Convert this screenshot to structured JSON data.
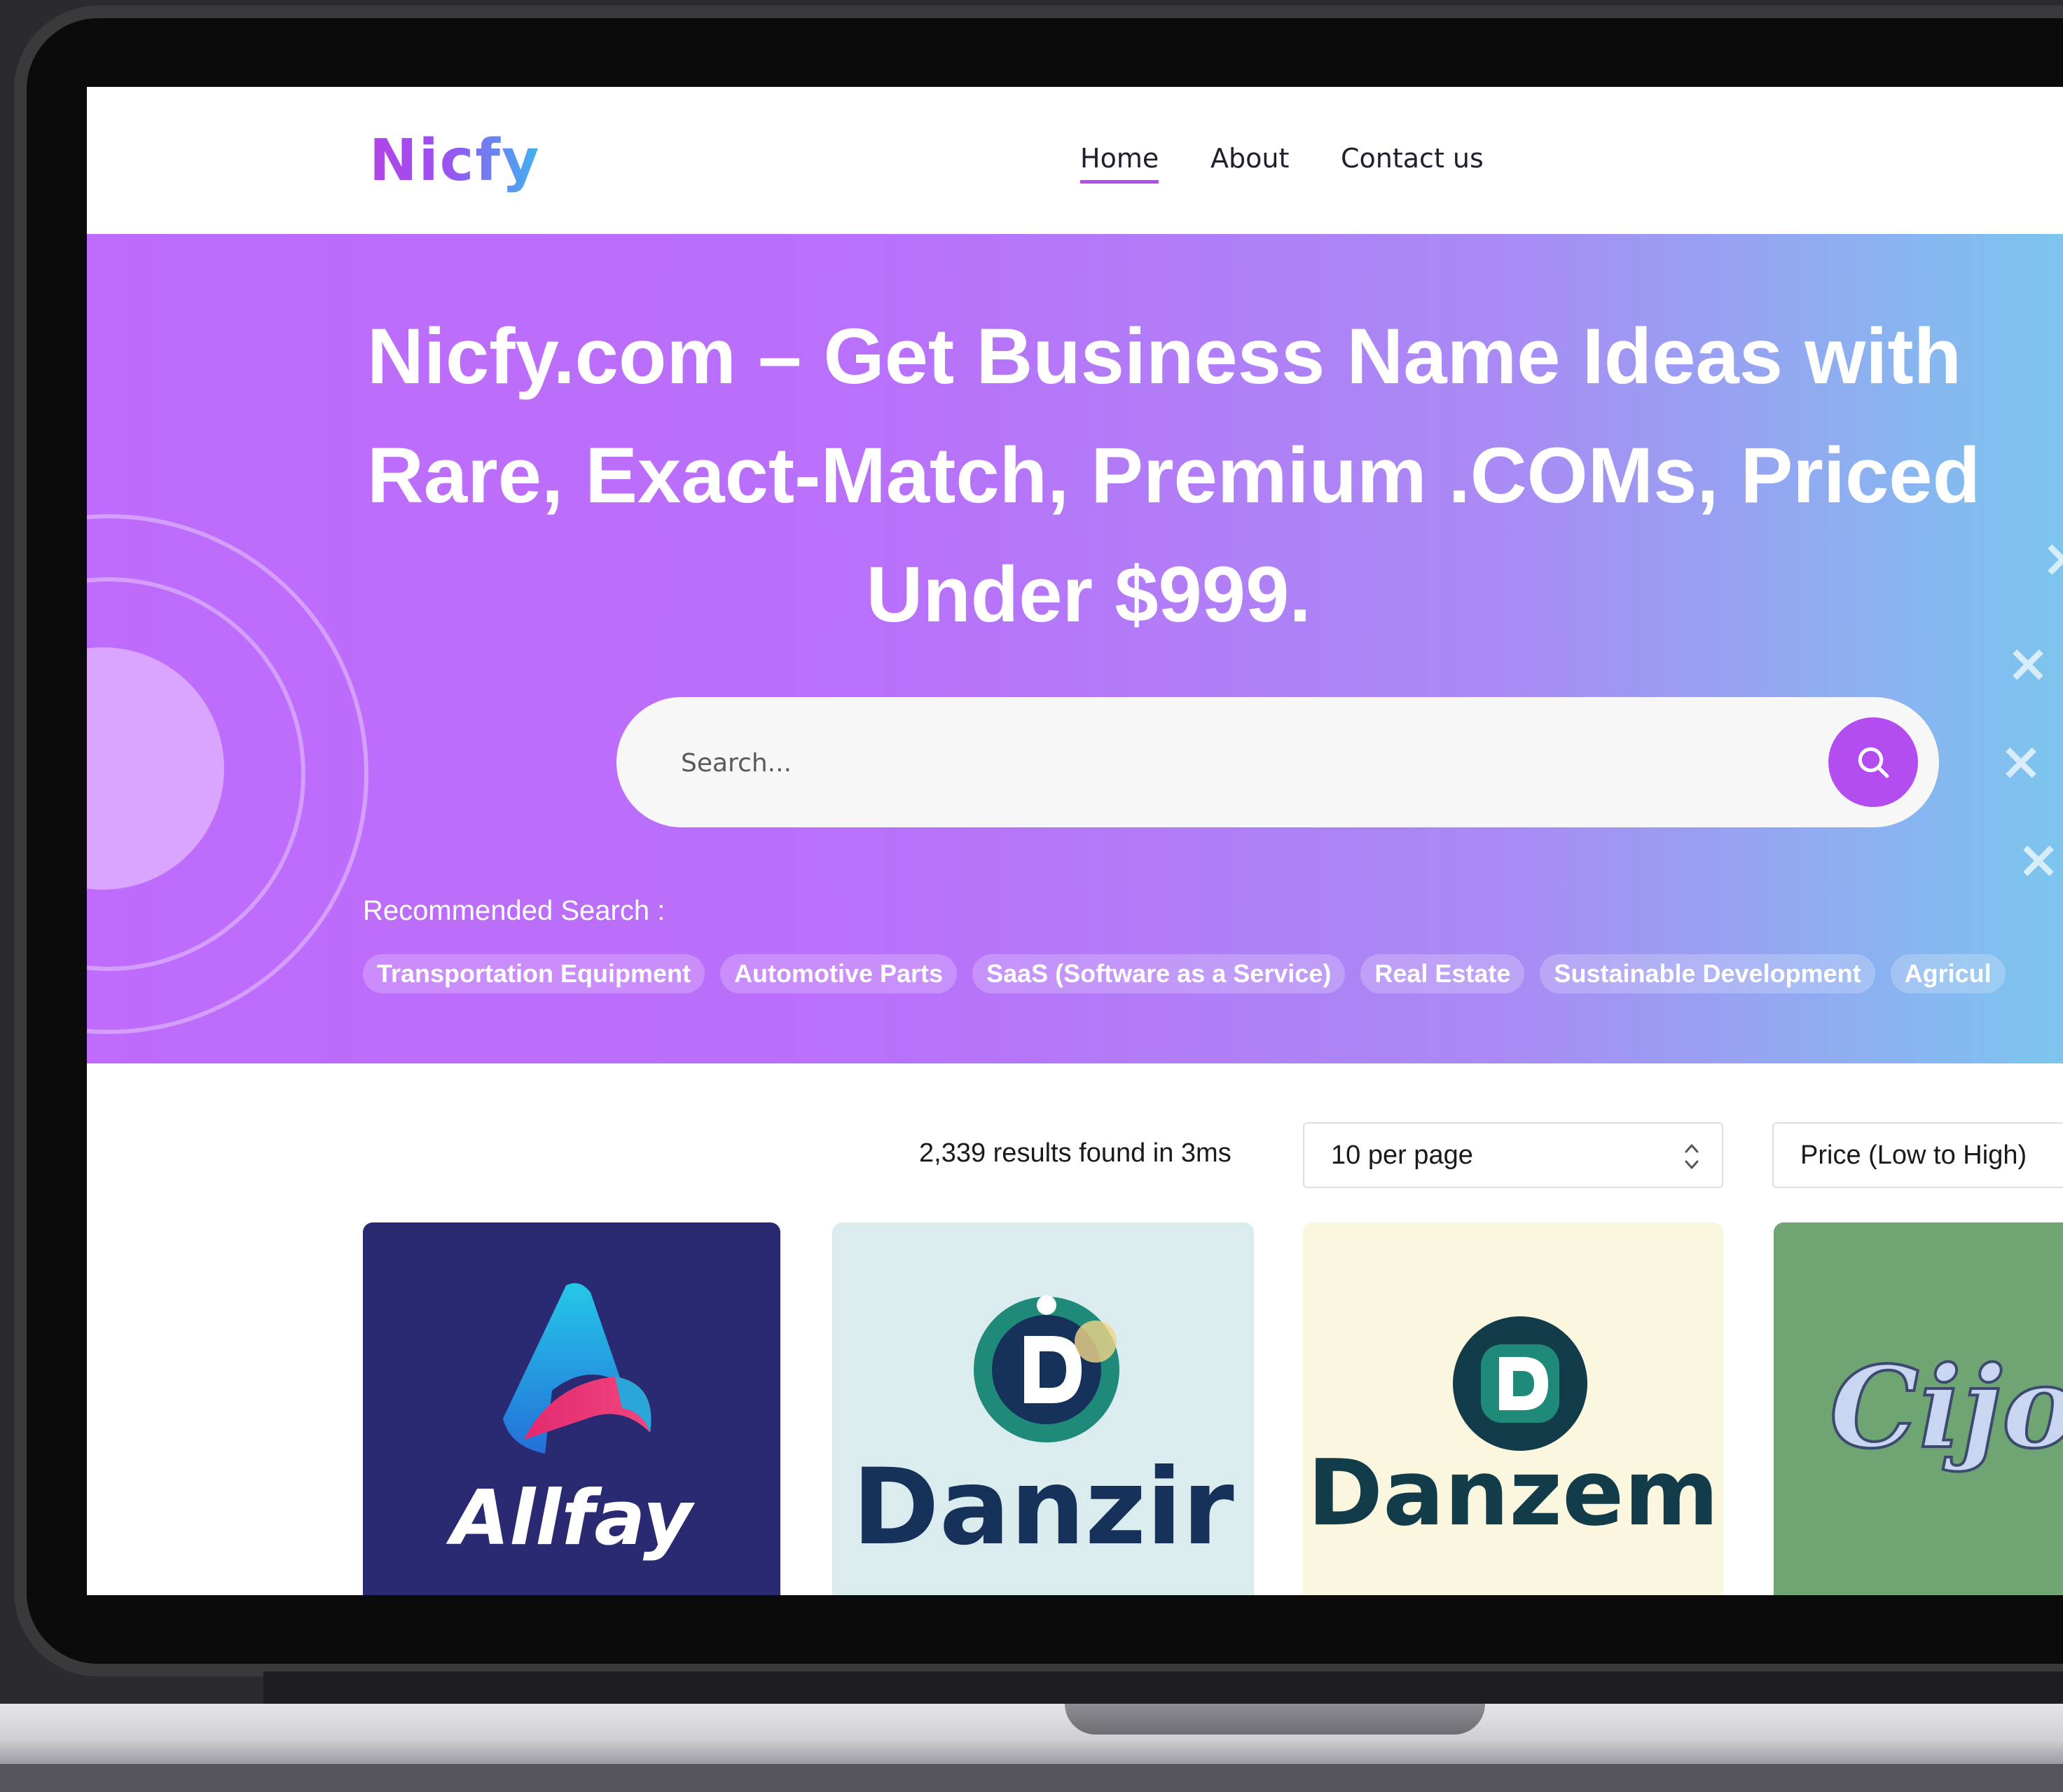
{
  "brand": {
    "logo_text": "Nicfy",
    "accent": "#b44df0"
  },
  "nav": {
    "items": [
      {
        "label": "Home",
        "active": true
      },
      {
        "label": "About",
        "active": false
      },
      {
        "label": "Contact us",
        "active": false
      }
    ]
  },
  "hero": {
    "title_lines": [
      "Nicfy.com – Get Business Name Ideas with",
      "Rare, Exact-Match, Premium .COMs, Priced",
      "Under $999."
    ],
    "search_placeholder": "Search...",
    "recommended_label": "Recommended Search :",
    "chips": [
      "Transportation Equipment",
      "Automotive Parts",
      "SaaS (Software as a Service)",
      "Real Estate",
      "Sustainable Development",
      "Agricul"
    ]
  },
  "results": {
    "count_text": "2,339 results found in 3ms",
    "per_page_value": "10 per page",
    "sort_value": "Price (Low to High)"
  },
  "cards": [
    {
      "name": "Allfay",
      "bg": "#2a2a73"
    },
    {
      "name": "Danzir",
      "bg": "#daeced"
    },
    {
      "name": "Danzem",
      "bg": "#fbf7df"
    },
    {
      "name": "Cijo",
      "bg": "#6ea572"
    }
  ],
  "icons": {
    "search": "search-icon",
    "select": "chevron-updown-icon"
  }
}
